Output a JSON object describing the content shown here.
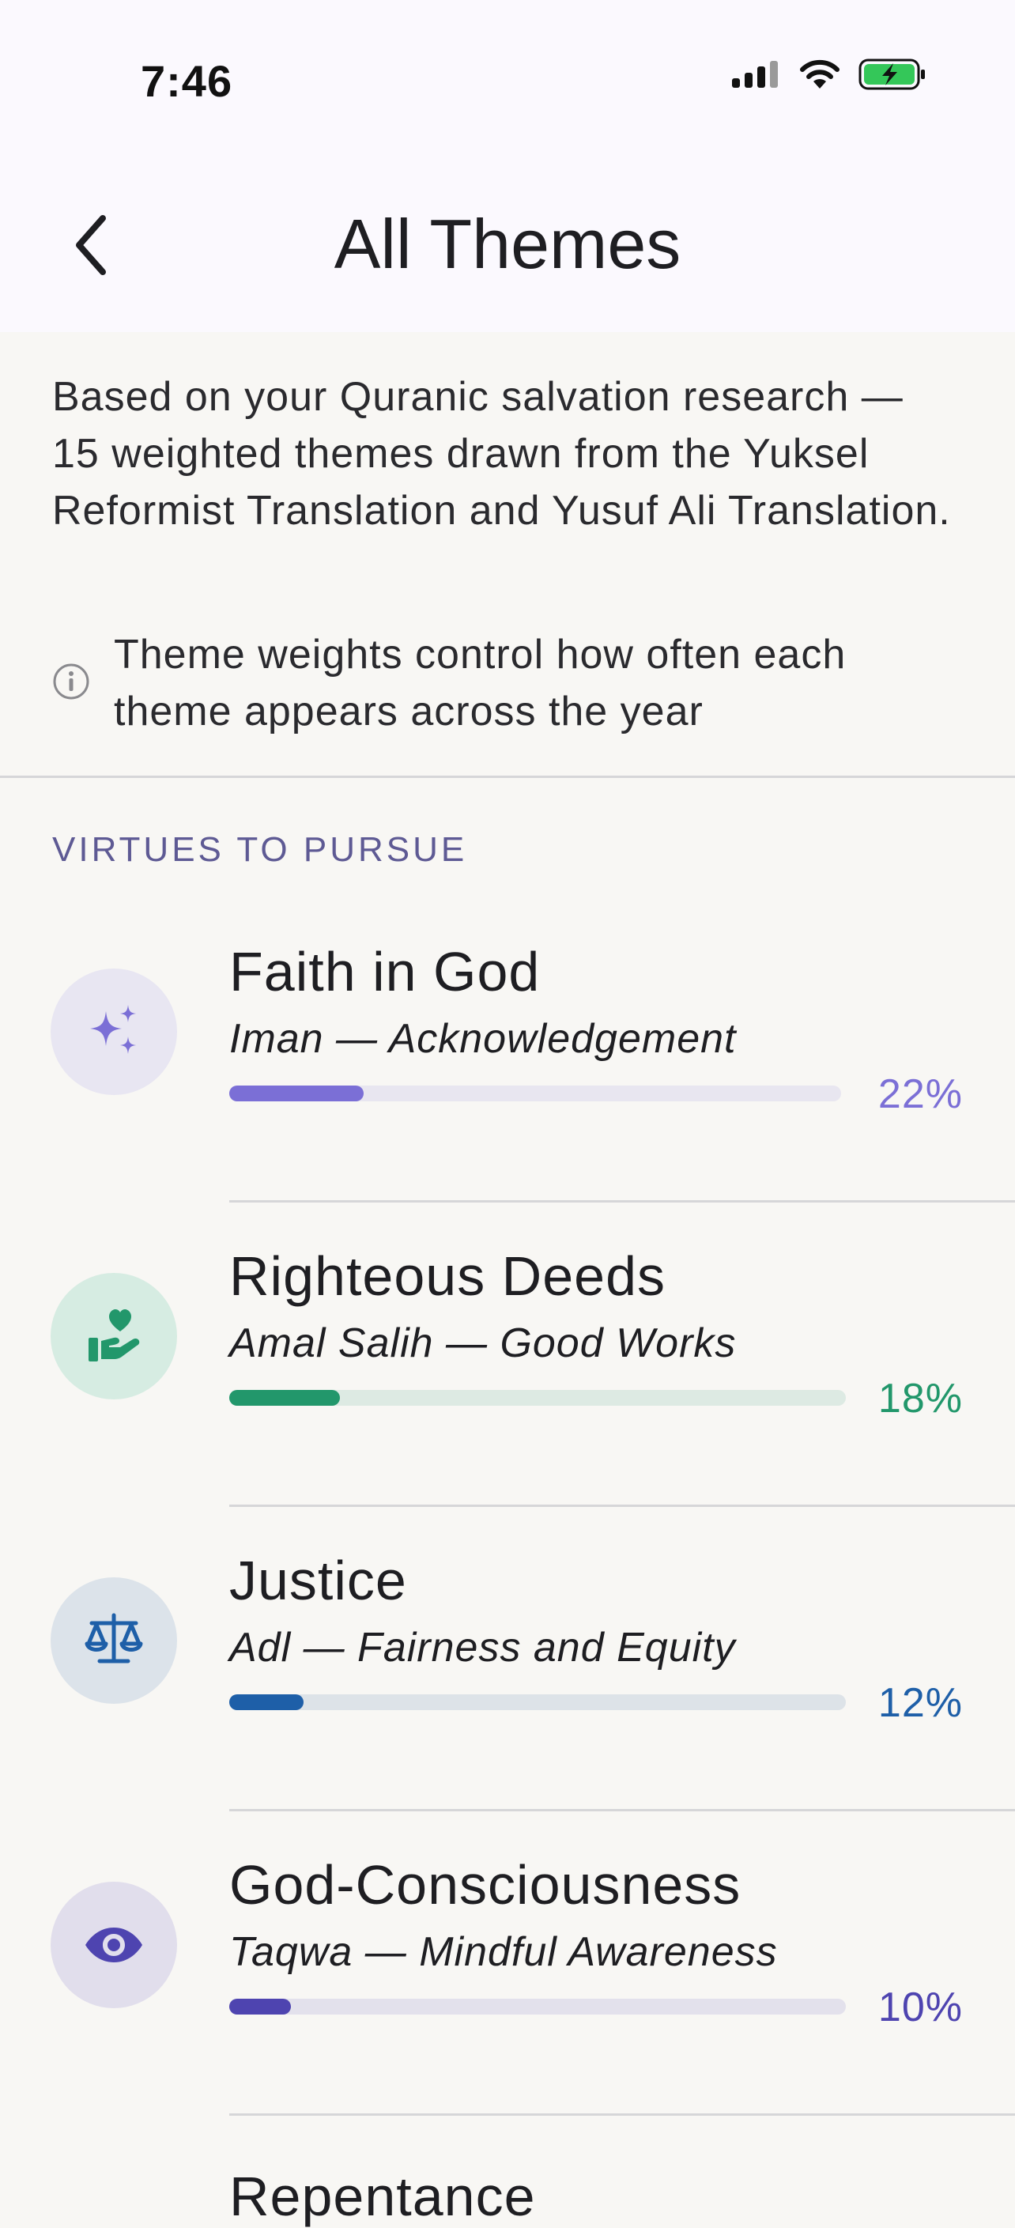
{
  "status_bar": {
    "time": "7:46",
    "icons": [
      "signal-icon",
      "wifi-icon",
      "battery-charging-icon"
    ]
  },
  "header": {
    "title": "All Themes",
    "back_icon": "chevron-left-icon"
  },
  "intro": {
    "text": "Based on your Quranic salvation research — 15 weighted themes drawn from the Yuksel Reformist Translation and Yusuf Ali Translation.",
    "info_icon": "info-circle-icon",
    "info_text": "Theme weights control how often each theme appears across the year"
  },
  "section": {
    "title": "VIRTUES TO PURSUE"
  },
  "themes": [
    {
      "name": "Faith in God",
      "subtitle": "Iman — Acknowledgement",
      "percent_label": "22%",
      "weight": 0.22,
      "icon": "sparkles-icon",
      "color": "#7B6FD6",
      "icon_bg": "#E8E6F2",
      "track_color": "#E8E6F0"
    },
    {
      "name": "Righteous Deeds",
      "subtitle": "Amal Salih — Good Works",
      "percent_label": "18%",
      "weight": 0.18,
      "icon": "hand-heart-icon",
      "color": "#22976B",
      "icon_bg": "#D6ECE2",
      "track_color": "#DDEAE3"
    },
    {
      "name": "Justice",
      "subtitle": "Adl — Fairness and Equity",
      "percent_label": "12%",
      "weight": 0.12,
      "icon": "scales-icon",
      "color": "#1E5FA8",
      "icon_bg": "#DCE3EA",
      "track_color": "#DDE3E8"
    },
    {
      "name": "God-Consciousness",
      "subtitle": "Taqwa — Mindful Awareness",
      "percent_label": "10%",
      "weight": 0.1,
      "icon": "eye-icon",
      "color": "#4E44B0",
      "icon_bg": "#E1DEEC",
      "track_color": "#E3E1EC"
    }
  ],
  "next_theme_peek": "Repentance"
}
